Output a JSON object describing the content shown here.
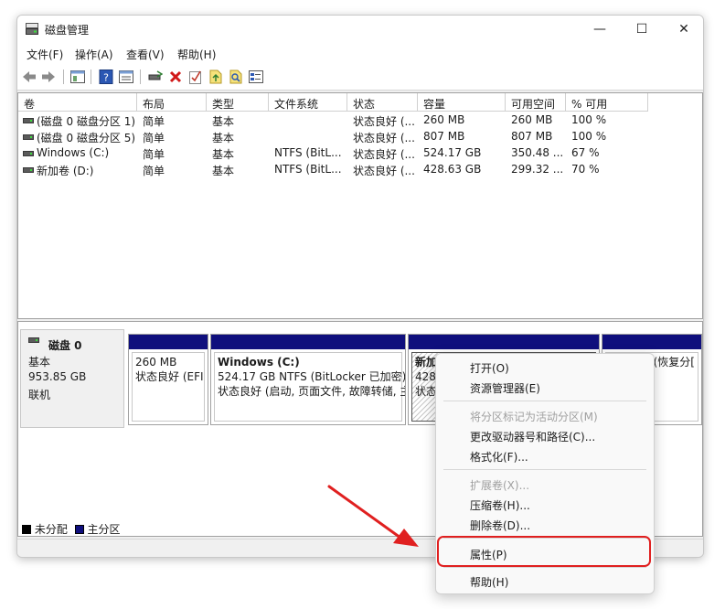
{
  "window": {
    "title": "磁盘管理",
    "controls": {
      "minimize": "—",
      "maximize": "☐",
      "close": "✕"
    }
  },
  "menu": [
    "文件(F)",
    "操作(A)",
    "查看(V)",
    "帮助(H)"
  ],
  "toolbar": [
    "back-icon",
    "forward-icon",
    "console-icon",
    "help-icon",
    "view-icon",
    "connect-icon",
    "delete-icon",
    "check-icon",
    "import-icon",
    "search-icon",
    "properties-icon"
  ],
  "columns": [
    "卷",
    "布局",
    "类型",
    "文件系统",
    "状态",
    "容量",
    "可用空间",
    "% 可用"
  ],
  "volumes": [
    {
      "name": "(磁盘 0 磁盘分区 1)",
      "layout": "简单",
      "type": "基本",
      "fs": "",
      "status": "状态良好 (...",
      "capacity": "260 MB",
      "free": "260 MB",
      "pct": "100 %"
    },
    {
      "name": "(磁盘 0 磁盘分区 5)",
      "layout": "简单",
      "type": "基本",
      "fs": "",
      "status": "状态良好 (...",
      "capacity": "807 MB",
      "free": "807 MB",
      "pct": "100 %"
    },
    {
      "name": "Windows (C:)",
      "layout": "简单",
      "type": "基本",
      "fs": "NTFS (BitL...",
      "status": "状态良好 (...",
      "capacity": "524.17 GB",
      "free": "350.48 ...",
      "pct": "67 %"
    },
    {
      "name": "新加卷 (D:)",
      "layout": "简单",
      "type": "基本",
      "fs": "NTFS (BitL...",
      "status": "状态良好 (...",
      "capacity": "428.63 GB",
      "free": "299.32 ...",
      "pct": "70 %"
    }
  ],
  "disk": {
    "name": "磁盘 0",
    "type": "基本",
    "size": "953.85 GB",
    "state": "联机",
    "partitions": [
      {
        "title": "",
        "line1": "260 MB",
        "line2": "状态良好 (EFI"
      },
      {
        "title": "Windows  (C:)",
        "line1": "524.17 GB NTFS (BitLocker 已加密)",
        "line2": "状态良好 (启动, 页面文件, 故障转储, 主"
      },
      {
        "title": "新加",
        "line1": "428.",
        "line2": "状态"
      },
      {
        "title": "",
        "line1": "",
        "line2": "(恢复分["
      }
    ]
  },
  "legend": {
    "unallocated": "未分配",
    "primary": "主分区",
    "colors": {
      "unallocated": "#000000",
      "primary": "#0f0f7d"
    }
  },
  "context_menu": {
    "open": "打开(O)",
    "explore": "资源管理器(E)",
    "mark_active": "将分区标记为活动分区(M)",
    "change_letter": "更改驱动器号和路径(C)...",
    "format": "格式化(F)...",
    "extend": "扩展卷(X)...",
    "shrink": "压缩卷(H)...",
    "delete": "删除卷(D)...",
    "properties": "属性(P)",
    "help": "帮助(H)"
  }
}
